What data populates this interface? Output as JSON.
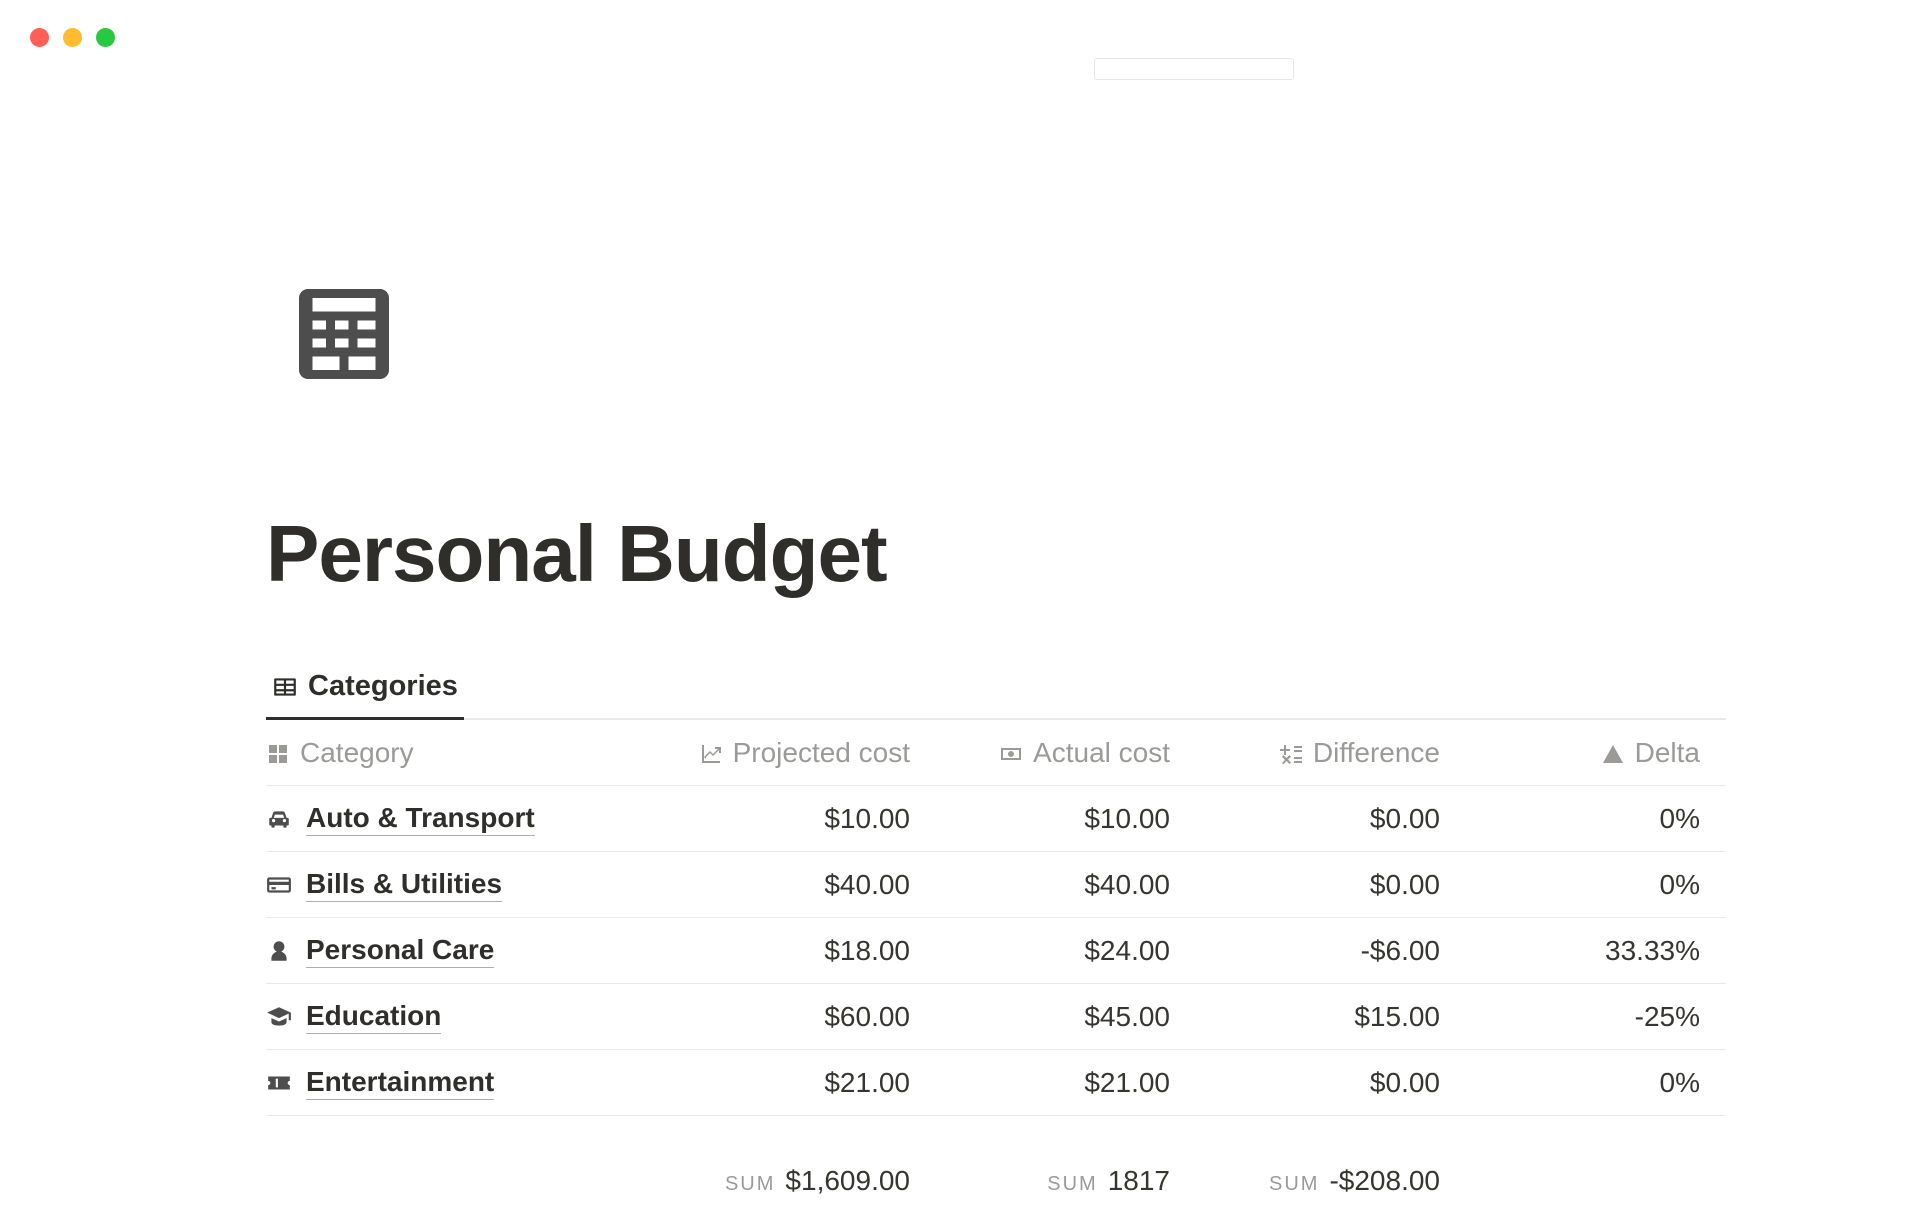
{
  "page": {
    "title": "Personal Budget"
  },
  "view": {
    "active_tab_label": "Categories"
  },
  "table": {
    "columns": {
      "category": "Category",
      "projected": "Projected cost",
      "actual": "Actual cost",
      "difference": "Difference",
      "delta": "Delta"
    },
    "rows": [
      {
        "icon": "car",
        "label": "Auto & Transport",
        "projected": "$10.00",
        "actual": "$10.00",
        "difference": "$0.00",
        "delta": "0%"
      },
      {
        "icon": "card",
        "label": "Bills & Utilities",
        "projected": "$40.00",
        "actual": "$40.00",
        "difference": "$0.00",
        "delta": "0%"
      },
      {
        "icon": "person",
        "label": "Personal Care",
        "projected": "$18.00",
        "actual": "$24.00",
        "difference": "-$6.00",
        "delta": "33.33%"
      },
      {
        "icon": "graduate",
        "label": "Education",
        "projected": "$60.00",
        "actual": "$45.00",
        "difference": "$15.00",
        "delta": "-25%"
      },
      {
        "icon": "ticket",
        "label": "Entertainment",
        "projected": "$21.00",
        "actual": "$21.00",
        "difference": "$0.00",
        "delta": "0%"
      }
    ],
    "sums": {
      "label": "SUM",
      "projected": "$1,609.00",
      "actual": "1817",
      "difference": "-$208.00"
    }
  }
}
